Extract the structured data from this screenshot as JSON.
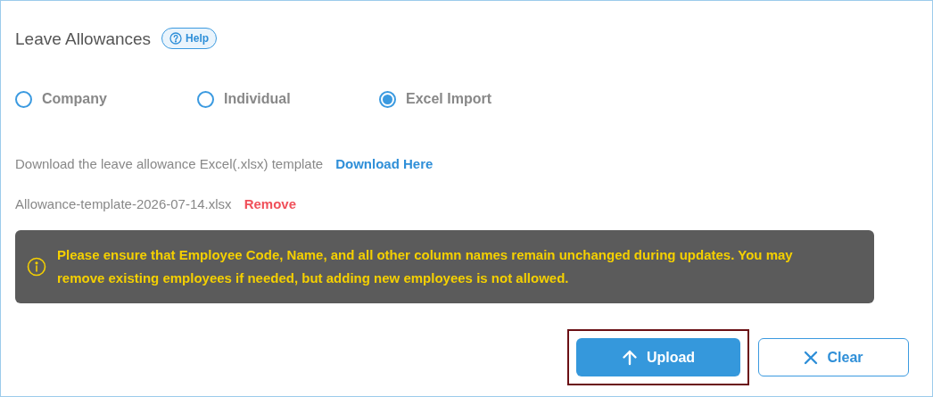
{
  "title": "Leave Allowances",
  "help_button": {
    "label": "Help"
  },
  "options": [
    {
      "label": "Company",
      "selected": false
    },
    {
      "label": "Individual",
      "selected": false
    },
    {
      "label": "Excel Import",
      "selected": true
    }
  ],
  "download": {
    "text": "Download the leave allowance Excel(.xlsx) template",
    "link": "Download Here"
  },
  "file": {
    "name": "Allowance-template-2026-07-14.xlsx",
    "remove": "Remove"
  },
  "notice": "Please ensure that Employee Code, Name, and all other column names remain unchanged during updates. You may remove existing employees if needed, but adding new employees is not allowed.",
  "buttons": [
    {
      "kind": "primary",
      "label": "Upload",
      "focused": true
    },
    {
      "kind": "secondary",
      "label": "Clear",
      "focused": false
    }
  ]
}
